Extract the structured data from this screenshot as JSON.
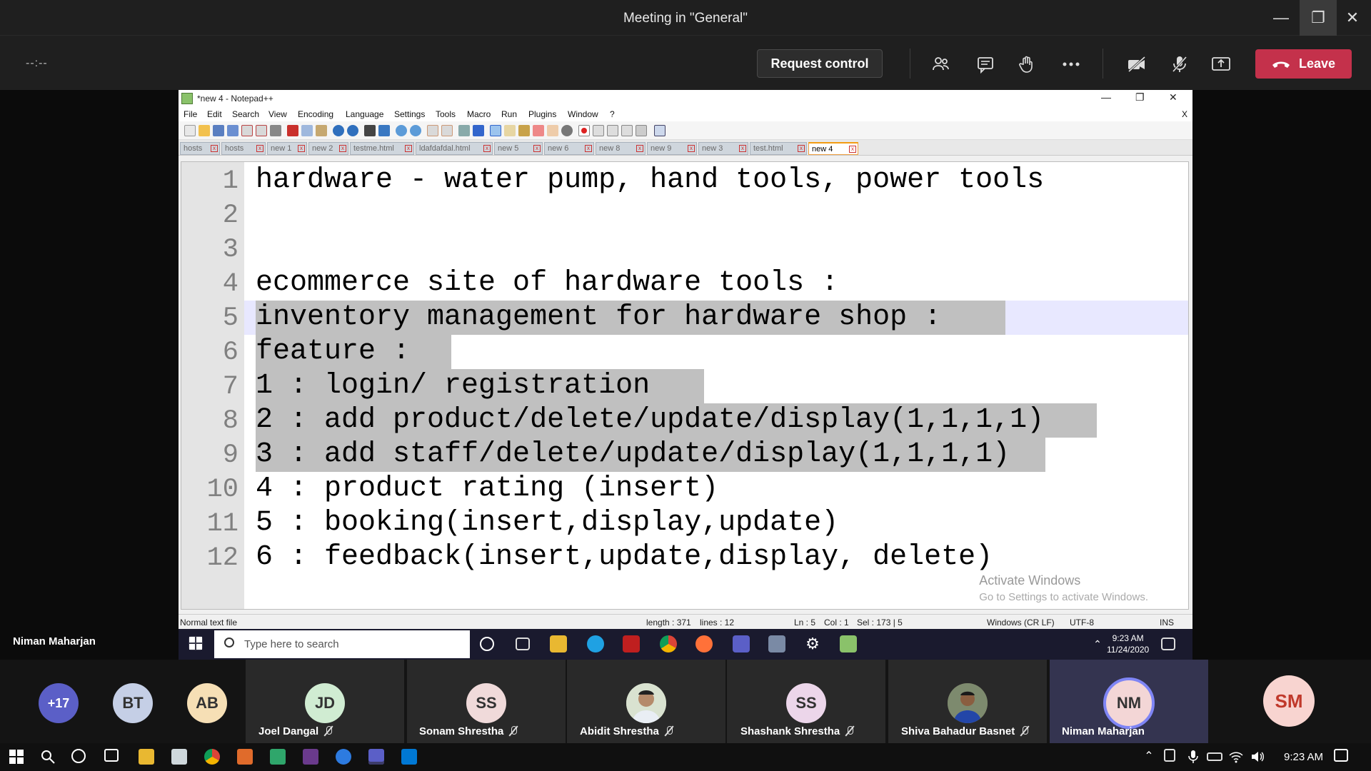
{
  "teams": {
    "window_title": "Meeting in \"General\"",
    "timer": "--:--",
    "request_control": "Request control",
    "leave": "Leave",
    "colors": {
      "leave": "#c4314b",
      "bar": "#1f1f1f"
    },
    "toolbar_icons": [
      "participants-icon",
      "chat-icon",
      "raise-hand-icon",
      "more-icon",
      "camera-off-icon",
      "mic-off-icon",
      "share-icon"
    ]
  },
  "notepad": {
    "title": "*new 4 - Notepad++",
    "menu": [
      "File",
      "Edit",
      "Search",
      "View",
      "Encoding",
      "Language",
      "Settings",
      "Tools",
      "Macro",
      "Run",
      "Plugins",
      "Window",
      "?"
    ],
    "close_doc": "X",
    "tabs": [
      "hosts",
      "hosts",
      "new 1",
      "new 2",
      "testme.html",
      "ldafdafdal.html",
      "new 5",
      "new 6",
      "new 8",
      "new 9",
      "new 3",
      "test.html",
      "new 4"
    ],
    "active_tab": "new 4",
    "lines": [
      {
        "num": "1",
        "text": "hardware - water pump, hand tools, power tools"
      },
      {
        "num": "2",
        "text": ""
      },
      {
        "num": "3",
        "text": ""
      },
      {
        "num": "4",
        "text": "ecommerce site of hardware tools :"
      },
      {
        "num": "5",
        "text": "inventory management for hardware shop :"
      },
      {
        "num": "6",
        "text": "feature :"
      },
      {
        "num": "7",
        "text": "1 : login/ registration"
      },
      {
        "num": "8",
        "text": "2 : add product/delete/update/display(1,1,1,1)"
      },
      {
        "num": "9",
        "text": "3 : add staff/delete/update/display(1,1,1,1)"
      },
      {
        "num": "10",
        "text": "4 : product rating (insert)"
      },
      {
        "num": "11",
        "text": "5 : booking(insert,display,update)"
      },
      {
        "num": "12",
        "text": "6 : feedback(insert,update,display, delete)"
      }
    ],
    "watermark_title": "Activate Windows",
    "watermark_sub": "Go to Settings to activate Windows.",
    "status": {
      "filetype": "Normal text file",
      "length": "length : 371",
      "lines": "lines : 12",
      "ln": "Ln : 5",
      "col": "Col : 1",
      "sel": "Sel : 173 | 5",
      "eol": "Windows (CR LF)",
      "encoding": "UTF-8",
      "mode": "INS"
    }
  },
  "inner_taskbar": {
    "search_placeholder": "Type here to search",
    "time": "9:23 AM",
    "date": "11/24/2020"
  },
  "presenter_name": "Niman Maharjan",
  "participants": {
    "overflow": "+17",
    "avatars": [
      {
        "initials": "BT",
        "color": "#c5cfe6"
      },
      {
        "initials": "AB",
        "color": "#f6dfb5"
      }
    ],
    "tiles": [
      {
        "initials": "JD",
        "name": "Joel Dangal",
        "color": "#d0ecd2",
        "muted": true
      },
      {
        "initials": "SS",
        "name": "Sonam Shrestha",
        "color": "#f0dada",
        "muted": true
      },
      {
        "initials": "",
        "name": "Abidit Shrestha",
        "color": "#b8c4a8",
        "muted": true
      },
      {
        "initials": "SS",
        "name": "Shashank Shrestha",
        "color": "#ecd6ea",
        "muted": true
      },
      {
        "initials": "",
        "name": "Shiva Bahadur Basnet",
        "color": "#6a5b4c",
        "muted": true
      },
      {
        "initials": "NM",
        "name": "Niman Maharjan",
        "color": "#f3d6d6",
        "muted": false
      },
      {
        "initials": "SM",
        "name": "",
        "color": "#f8d4d0",
        "muted": false
      }
    ]
  },
  "windows_taskbar": {
    "time": "9:23 AM"
  }
}
